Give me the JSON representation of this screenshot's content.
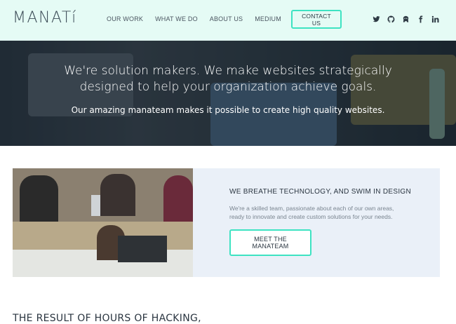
{
  "header": {
    "logo": "MANATí",
    "nav": [
      {
        "label": "OUR WORK"
      },
      {
        "label": "WHAT WE DO"
      },
      {
        "label": "ABOUT US"
      },
      {
        "label": "MEDIUM"
      }
    ],
    "contact_label": "CONTACT US",
    "social": [
      "twitter-icon",
      "github-icon",
      "github-alt-icon",
      "facebook-icon",
      "linkedin-icon"
    ]
  },
  "hero": {
    "title": "We're solution makers. We make websites strategically designed to help your organization achieve goals.",
    "subtitle": "Our amazing manateam makes it possible to create high quality websites."
  },
  "feature": {
    "title": "WE BREATHE TECHNOLOGY, AND SWIM IN DESIGN",
    "description": "We're a skilled team, passionate about each of our own areas, ready to innovate and create custom solutions for your needs.",
    "button_label": "MEET THE MANATEAM"
  },
  "result": {
    "heading": "THE RESULT OF HOURS OF HACKING,"
  },
  "colors": {
    "header_bg": "#e5fbf5",
    "accent": "#3ee3c2",
    "feature_bg": "#eaf0f8"
  }
}
